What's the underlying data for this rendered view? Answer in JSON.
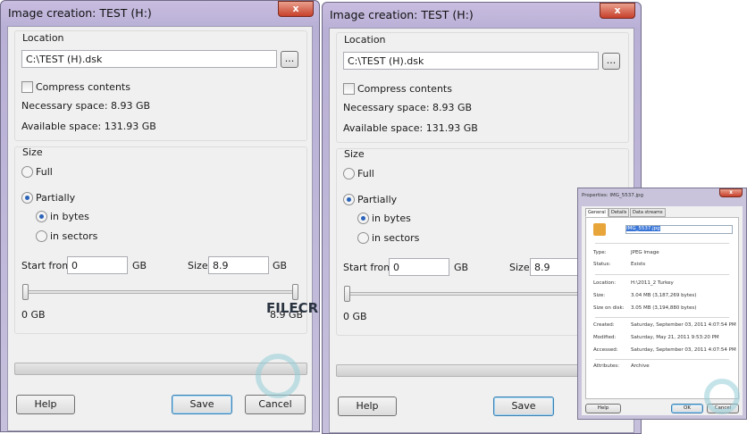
{
  "dialogs": [
    {
      "title": "Image creation: TEST (H:)",
      "close": "x",
      "location_label": "Location",
      "path": "C:\\TEST (H).dsk",
      "browse": "...",
      "compress": "Compress contents",
      "necessary": "Necessary space: 8.93 GB",
      "available": "Available space: 131.93 GB",
      "size_label": "Size",
      "full": "Full",
      "partially": "Partially",
      "in_bytes": "in bytes",
      "in_sectors": "in sectors",
      "start_from": "Start from",
      "start_value": "0",
      "gb": "GB",
      "size": "Size",
      "size_value": "8.9",
      "slider_min": "0 GB",
      "slider_max": "8.9 GB",
      "help": "Help",
      "save": "Save",
      "cancel": "Cancel"
    },
    {
      "title": "Image creation: TEST (H:)",
      "close": "x",
      "location_label": "Location",
      "path": "C:\\TEST (H).dsk",
      "browse": "...",
      "compress": "Compress contents",
      "necessary": "Necessary space: 8.93 GB",
      "available": "Available space: 131.93 GB",
      "size_label": "Size",
      "full": "Full",
      "partially": "Partially",
      "in_bytes": "in bytes",
      "in_sectors": "in sectors",
      "start_from": "Start from",
      "start_value": "0",
      "gb": "GB",
      "size": "Size",
      "size_value": "8.9",
      "slider_min": "0 GB",
      "help": "Help",
      "save": "Save"
    }
  ],
  "properties": {
    "title": "Properties: IMG_5537.jpg",
    "tabs": [
      "General",
      "Details",
      "Data streams"
    ],
    "filename": "IMG_5537.jpg",
    "rows": [
      [
        "Type:",
        "JPEG Image"
      ],
      [
        "Status:",
        "Exists"
      ],
      [
        "Location:",
        "H:\\2011_2 Turkey"
      ],
      [
        "Size:",
        "3.04 MB (3,187,269 bytes)"
      ],
      [
        "Size on disk:",
        "3.05 MB (3,194,880 bytes)"
      ],
      [
        "Created:",
        "Saturday, September 03, 2011 4:07:54 PM"
      ],
      [
        "Modified:",
        "Saturday, May 21, 2011 9:53:20 PM"
      ],
      [
        "Accessed:",
        "Saturday, September 03, 2011 4:07:54 PM"
      ],
      [
        "Attributes:",
        "Archive"
      ]
    ],
    "help": "Help",
    "ok": "OK",
    "cancel": "Cancel"
  },
  "watermark": "FILECR"
}
